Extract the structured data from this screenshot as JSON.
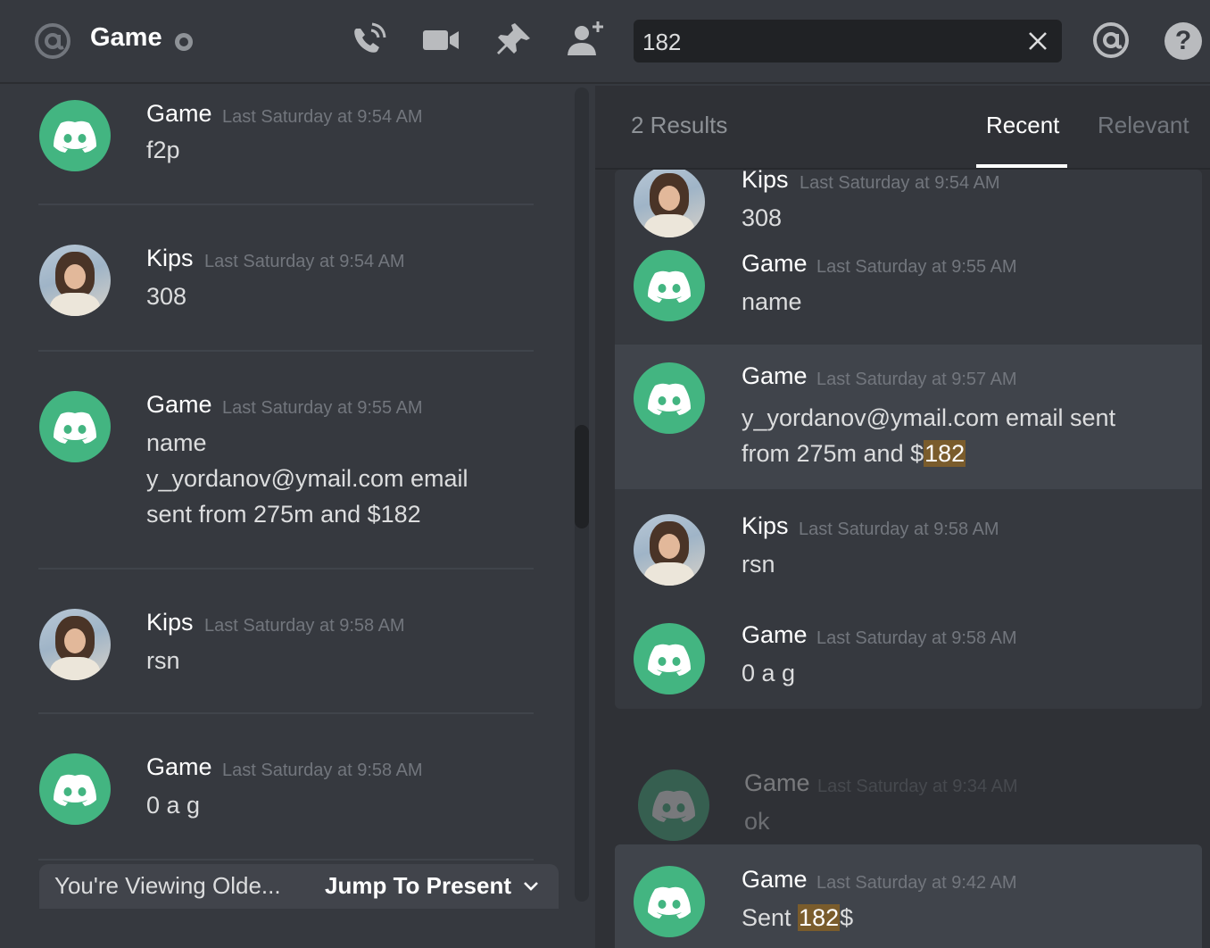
{
  "header": {
    "channel_name": "Game",
    "search_value": "182",
    "icons": [
      "at-icon",
      "status-icon",
      "call-icon",
      "video-icon",
      "pin-icon",
      "add-friend-icon",
      "close-icon",
      "mentions-icon",
      "help-icon"
    ]
  },
  "chat": {
    "messages": [
      {
        "author": "Game",
        "time": "Last Saturday at 9:54 AM",
        "lines": [
          "f2p"
        ],
        "avatar": "discord-logo"
      },
      {
        "author": "Kips",
        "time": "Last Saturday at 9:54 AM",
        "lines": [
          "308"
        ],
        "avatar": "photo"
      },
      {
        "author": "Game",
        "time": "Last Saturday at 9:55 AM",
        "lines": [
          "name",
          "y_yordanov@ymail.com email",
          "sent from 275m and $182"
        ],
        "avatar": "discord-logo"
      },
      {
        "author": "Kips",
        "time": "Last Saturday at 9:58 AM",
        "lines": [
          "rsn"
        ],
        "avatar": "photo"
      },
      {
        "author": "Game",
        "time": "Last Saturday at 9:58 AM",
        "lines": [
          "0 a g"
        ],
        "avatar": "discord-logo"
      }
    ],
    "older_notice": "You're Viewing Olde...",
    "jump_label": "Jump To Present"
  },
  "search_panel": {
    "result_count": "2 Results",
    "tabs": [
      "Recent",
      "Relevant"
    ],
    "active_tab": "Recent",
    "group1": [
      {
        "author": "Kips",
        "time": "Last Saturday at 9:54 AM",
        "text": "308",
        "avatar": "photo"
      },
      {
        "author": "Game",
        "time": "Last Saturday at 9:55 AM",
        "text": "name",
        "avatar": "discord-logo"
      },
      {
        "author": "Game",
        "time": "Last Saturday at 9:57 AM",
        "line1": "y_yordanov@ymail.com email sent",
        "line2_pre": "from 275m and $",
        "line2_hl": "182",
        "avatar": "discord-logo",
        "highlighted": true
      },
      {
        "author": "Kips",
        "time": "Last Saturday at 9:58 AM",
        "text": "rsn",
        "avatar": "photo"
      },
      {
        "author": "Game",
        "time": "Last Saturday at 9:58 AM",
        "text": "0 a g",
        "avatar": "discord-logo"
      }
    ],
    "group2": [
      {
        "author": "Game",
        "time": "Last Saturday at 9:34 AM",
        "text": "ok",
        "avatar": "discord-logo",
        "context": true
      },
      {
        "author": "Game",
        "time": "Last Saturday at 9:42 AM",
        "pre": "Sent ",
        "hl": "182",
        "post": "$",
        "avatar": "discord-logo",
        "highlighted": true
      }
    ]
  },
  "colors": {
    "background": "#36393f",
    "panel": "#2f3136",
    "discord_green": "#43b581",
    "highlight": "#7a5c2c"
  }
}
